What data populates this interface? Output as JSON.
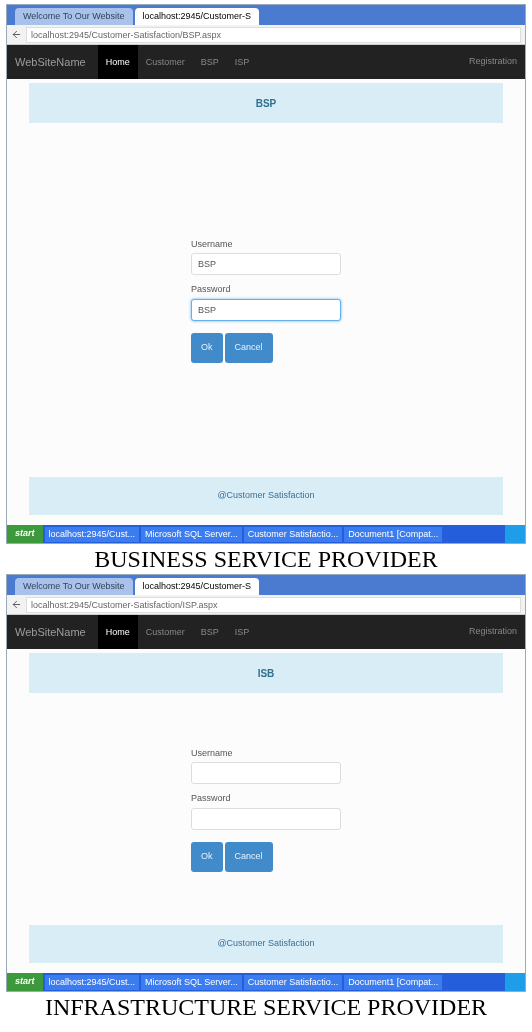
{
  "panels": [
    {
      "browser_tabs": [
        {
          "label": "Welcome To Our Website",
          "selected": false
        },
        {
          "label": "localhost:2945/Customer-S",
          "selected": true
        }
      ],
      "url": "localhost:2945/Customer-Satisfaction/BSP.aspx",
      "brand": "WebSiteName",
      "nav": [
        {
          "label": "Home",
          "selected": true
        },
        {
          "label": "Customer",
          "selected": false
        },
        {
          "label": "BSP",
          "selected": false
        },
        {
          "label": "ISP",
          "selected": false
        }
      ],
      "registration": "Registration",
      "header": "BSP",
      "fields": [
        {
          "label": "Username",
          "value": "BSP",
          "focused": false
        },
        {
          "label": "Password",
          "value": "BSP",
          "focused": true
        }
      ],
      "buttons": [
        "Ok",
        "Cancel"
      ],
      "footer": "@Customer Satisfaction",
      "taskbar": {
        "start": "start",
        "tasks": [
          "localhost:2945/Cust...",
          "Microsoft SQL Server...",
          "Customer Satisfactio...",
          "Document1 [Compat..."
        ]
      },
      "caption": "BUSINESS SERVICE PROVIDER"
    },
    {
      "browser_tabs": [
        {
          "label": "Welcome To Our Website",
          "selected": false
        },
        {
          "label": "localhost:2945/Customer-S",
          "selected": true
        }
      ],
      "url": "localhost:2945/Customer-Satisfaction/ISP.aspx",
      "brand": "WebSiteName",
      "nav": [
        {
          "label": "Home",
          "selected": true
        },
        {
          "label": "Customer",
          "selected": false
        },
        {
          "label": "BSP",
          "selected": false
        },
        {
          "label": "ISP",
          "selected": false
        }
      ],
      "registration": "Registration",
      "header": "ISB",
      "fields": [
        {
          "label": "Username",
          "focused": false
        },
        {
          "label": "Password",
          "focused": false
        }
      ],
      "buttons": [
        "Ok",
        "Cancel"
      ],
      "footer": "@Customer Satisfaction",
      "taskbar": {
        "start": "start",
        "tasks": [
          "localhost:2945/Cust...",
          "Microsoft SQL Server...",
          "Customer Satisfactio...",
          "Document1 [Compat..."
        ]
      },
      "caption": "INFRASTRUCTURE SERVICE PROVIDER"
    }
  ]
}
